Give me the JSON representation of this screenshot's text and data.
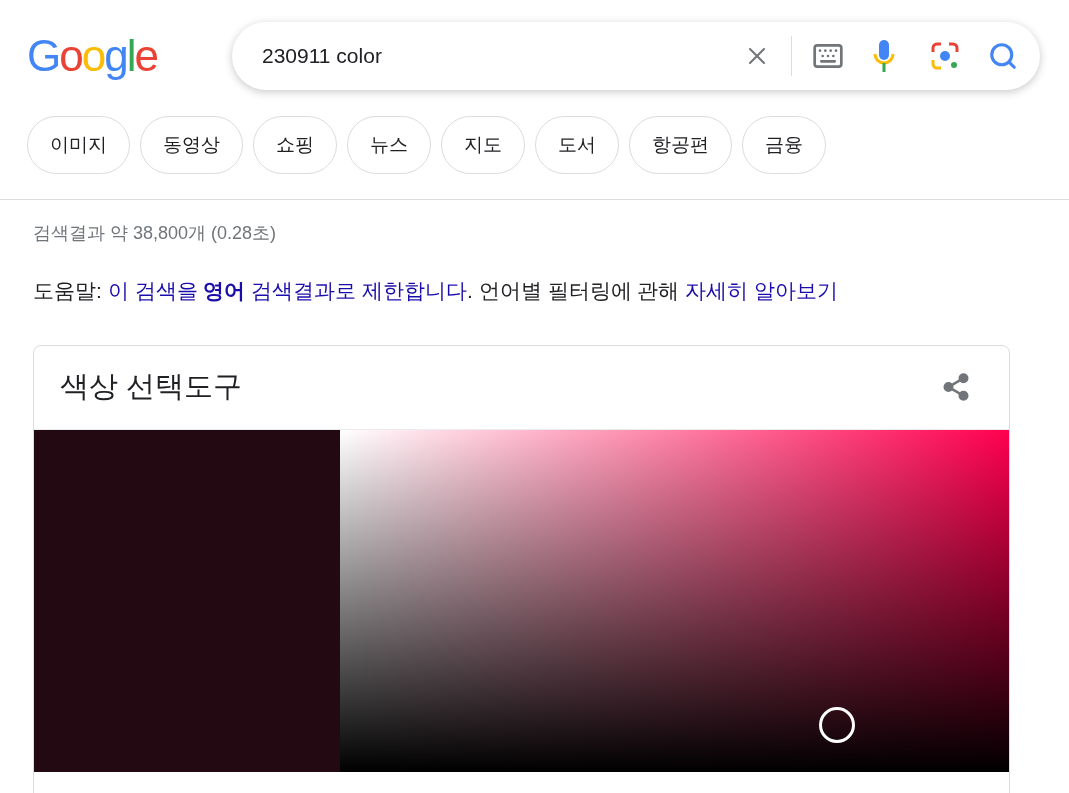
{
  "logo": "Google",
  "search": {
    "value": "230911 color"
  },
  "chips": [
    "이미지",
    "동영상",
    "쇼핑",
    "뉴스",
    "지도",
    "도서",
    "항공편",
    "금융"
  ],
  "result_stats": "검색결과 약 38,800개 (0.28초)",
  "help": {
    "label": "도움말:",
    "link": "이 검색을 **영어** 검색결과로 제한합니다",
    "middle": ". 언어별 필터링에 관해",
    "more_link": "자세히 알아보기"
  },
  "color_picker": {
    "title": "색상 선택도구",
    "color": "#230911"
  }
}
